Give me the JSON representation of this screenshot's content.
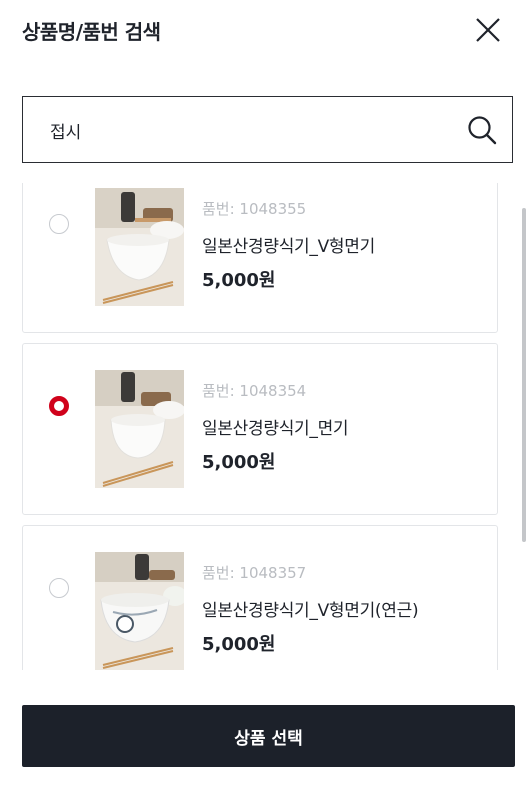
{
  "header": {
    "title": "상품명/품번 검색",
    "close_icon": "close-icon"
  },
  "search": {
    "value": "접시",
    "icon": "search-icon"
  },
  "products": [
    {
      "code": "품번: 1048355",
      "name": "일본산경량식기_V형면기",
      "price": "5,000원",
      "selected": false
    },
    {
      "code": "품번: 1048354",
      "name": "일본산경량식기_면기",
      "price": "5,000원",
      "selected": true
    },
    {
      "code": "품번: 1048357",
      "name": "일본산경량식기_V형면기(연근)",
      "price": "5,000원",
      "selected": false
    }
  ],
  "footer": {
    "select_label": "상품 선택"
  },
  "colors": {
    "accent": "#d0021b",
    "button_bg": "#1c212a",
    "border": "#e3e5e8"
  }
}
